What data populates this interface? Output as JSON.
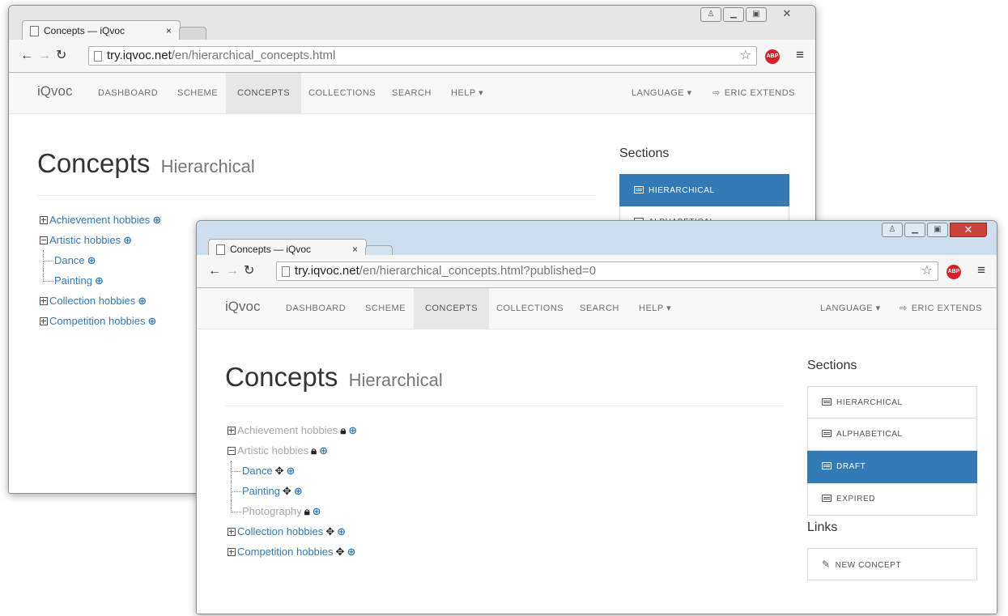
{
  "back_window": {
    "tab_title": "Concepts — iQvoc",
    "tab_close": "×",
    "url_host": "try.iqvoc.net",
    "url_path": "/en/hierarchical_concepts.html",
    "brand": "iQvoc",
    "nav": [
      "DASHBOARD",
      "SCHEME",
      "CONCEPTS",
      "COLLECTIONS",
      "SEARCH",
      "HELP ▾"
    ],
    "nav_active": "CONCEPTS",
    "nav_right": [
      "LANGUAGE ▾",
      "ERIC EXTENDS"
    ],
    "heading": "Concepts",
    "heading_small": "Hierarchical",
    "tree": [
      {
        "label": "Achievement hobbies",
        "level": 0,
        "toggle": "plus"
      },
      {
        "label": "Artistic hobbies",
        "level": 0,
        "toggle": "minus"
      },
      {
        "label": "Dance",
        "level": 1
      },
      {
        "label": "Painting",
        "level": 1
      },
      {
        "label": "Collection hobbies",
        "level": 0,
        "toggle": "plus"
      },
      {
        "label": "Competition hobbies",
        "level": 0,
        "toggle": "plus"
      }
    ],
    "sections_title": "Sections",
    "sections": [
      "HIERARCHICAL",
      "ALPHABETICAL"
    ],
    "sections_active": "HIERARCHICAL"
  },
  "front_window": {
    "tab_title": "Concepts — iQvoc",
    "tab_close": "×",
    "url_host": "try.iqvoc.net",
    "url_path": "/en/hierarchical_concepts.html?published=0",
    "brand": "iQvoc",
    "nav": [
      "DASHBOARD",
      "SCHEME",
      "CONCEPTS",
      "COLLECTIONS",
      "SEARCH",
      "HELP ▾"
    ],
    "nav_active": "CONCEPTS",
    "nav_right": [
      "LANGUAGE ▾",
      "ERIC EXTENDS"
    ],
    "heading": "Concepts",
    "heading_small": "Hierarchical",
    "tree": [
      {
        "label": "Achievement hobbies",
        "level": 0,
        "toggle": "plus",
        "state": "locked"
      },
      {
        "label": "Artistic hobbies",
        "level": 0,
        "toggle": "minus",
        "state": "locked"
      },
      {
        "label": "Dance",
        "level": 1,
        "state": "movable"
      },
      {
        "label": "Painting",
        "level": 1,
        "state": "movable"
      },
      {
        "label": "Photography",
        "level": 1,
        "state": "locked"
      },
      {
        "label": "Collection hobbies",
        "level": 0,
        "toggle": "plus",
        "state": "movable"
      },
      {
        "label": "Competition hobbies",
        "level": 0,
        "toggle": "plus",
        "state": "movable"
      }
    ],
    "sections_title": "Sections",
    "sections": [
      "HIERARCHICAL",
      "ALPHABETICAL",
      "DRAFT",
      "EXPIRED"
    ],
    "sections_active": "DRAFT",
    "links_title": "Links",
    "links": [
      "NEW CONCEPT"
    ]
  },
  "icons": {
    "search": "zoom-in-icon",
    "lock": "lock-icon",
    "move": "move-icon",
    "list": "list-icon",
    "signout": "sign-out-icon",
    "edit": "edit-icon"
  },
  "colors": {
    "link": "#337ab7",
    "muted": "#a8a8a8",
    "active_section": "#337ab7"
  }
}
